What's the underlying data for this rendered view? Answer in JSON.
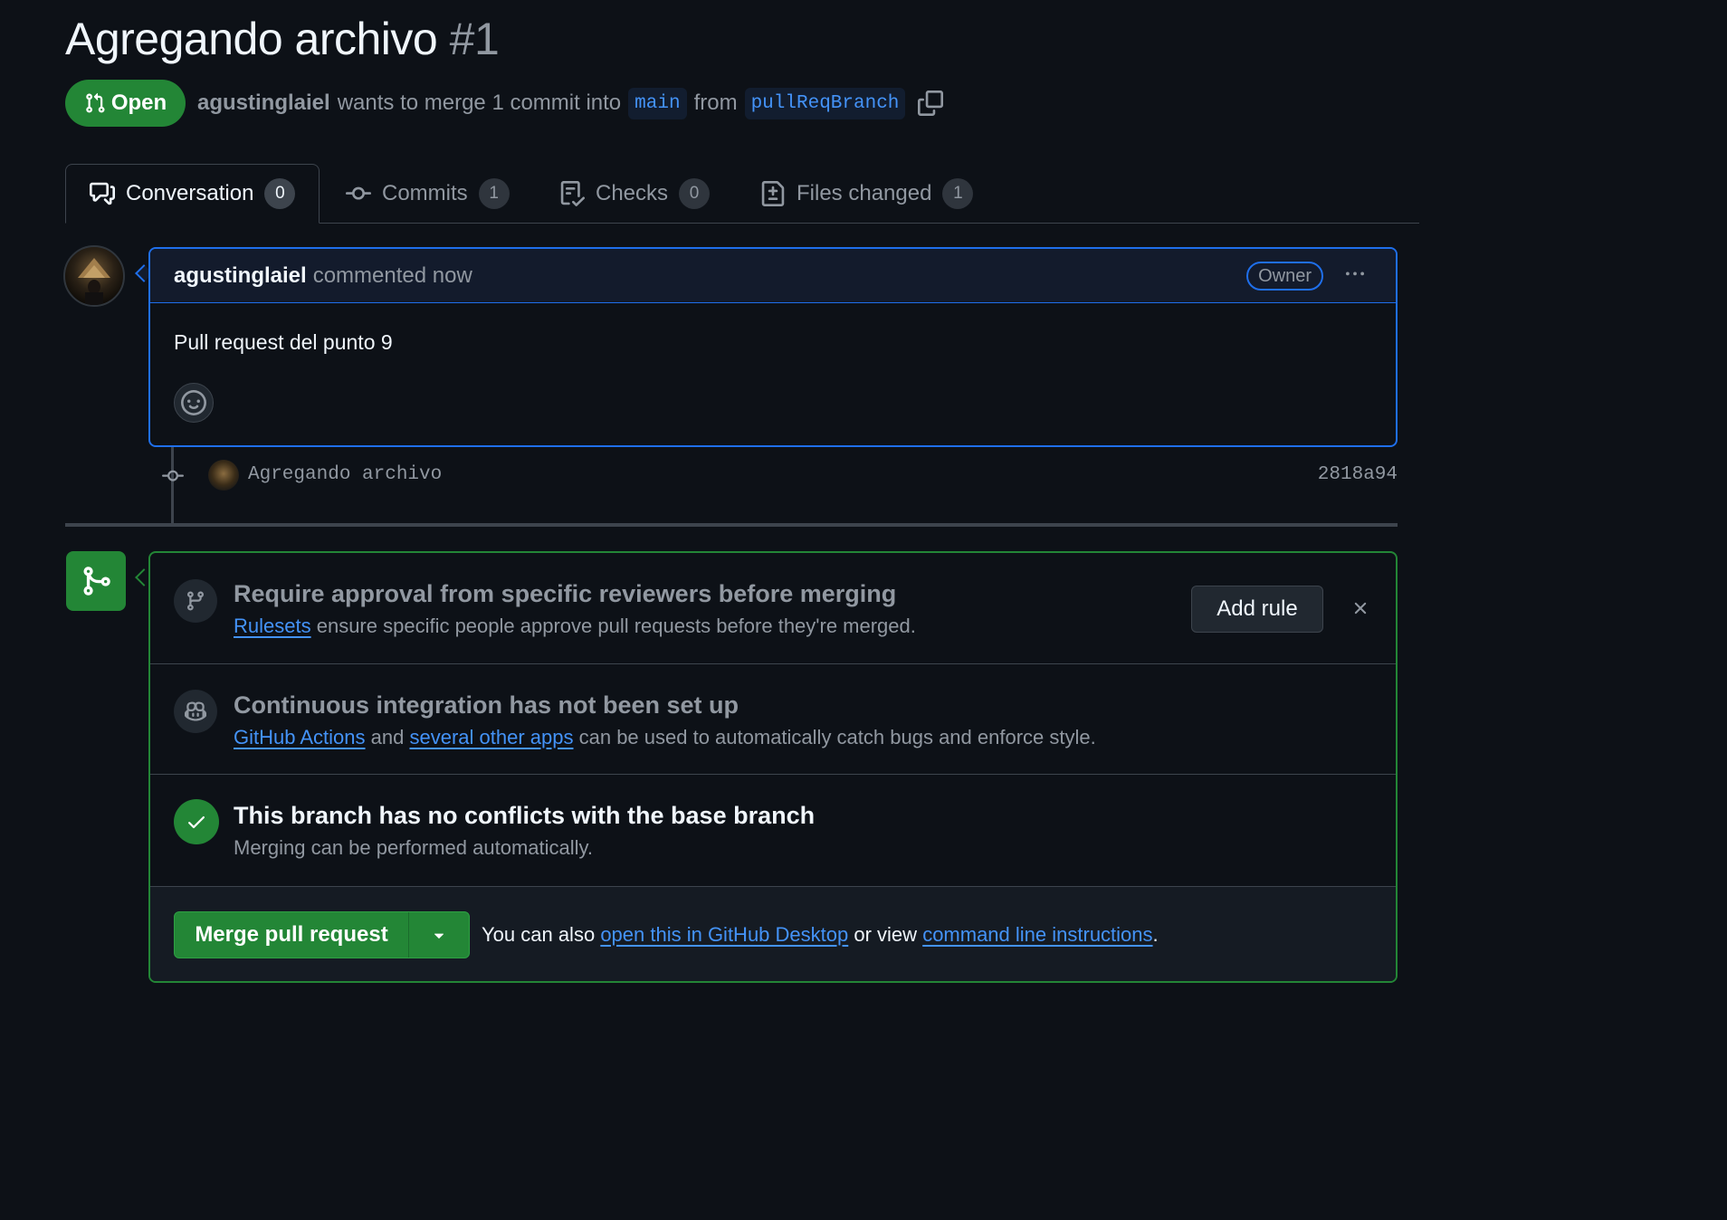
{
  "header": {
    "title": "Agregando archivo",
    "number": "#1",
    "state": "Open",
    "author": "agustinglaiel",
    "merge_text": "wants to merge 1 commit into",
    "base_branch": "main",
    "from_text": "from",
    "head_branch": "pullReqBranch"
  },
  "tabs": [
    {
      "label": "Conversation",
      "count": "0",
      "icon": "comment-discussion-icon"
    },
    {
      "label": "Commits",
      "count": "1",
      "icon": "git-commit-icon"
    },
    {
      "label": "Checks",
      "count": "0",
      "icon": "checklist-icon"
    },
    {
      "label": "Files changed",
      "count": "1",
      "icon": "file-diff-icon"
    }
  ],
  "comment": {
    "author": "agustinglaiel",
    "timestamp": "commented now",
    "role": "Owner",
    "body": "Pull request del punto 9"
  },
  "commit": {
    "message": "Agregando archivo",
    "sha": "2818a94"
  },
  "mergebox": {
    "rule": {
      "title": "Require approval from specific reviewers before merging",
      "link": "Rulesets",
      "desc": "ensure specific people approve pull requests before they're merged.",
      "button": "Add rule"
    },
    "ci": {
      "title": "Continuous integration has not been set up",
      "link1": "GitHub Actions",
      "and": "and",
      "link2": "several other apps",
      "desc": "can be used to automatically catch bugs and enforce style."
    },
    "conflicts": {
      "title": "This branch has no conflicts with the base branch",
      "desc": "Merging can be performed automatically."
    },
    "footer": {
      "merge_button": "Merge pull request",
      "prefix": "You can also",
      "link1": "open this in GitHub Desktop",
      "middle": "or view",
      "link2": "command line instructions",
      "suffix": "."
    }
  },
  "colors": {
    "background": "#0d1117",
    "success": "#238636",
    "accent": "#1f6feb",
    "link": "#4493f8"
  }
}
